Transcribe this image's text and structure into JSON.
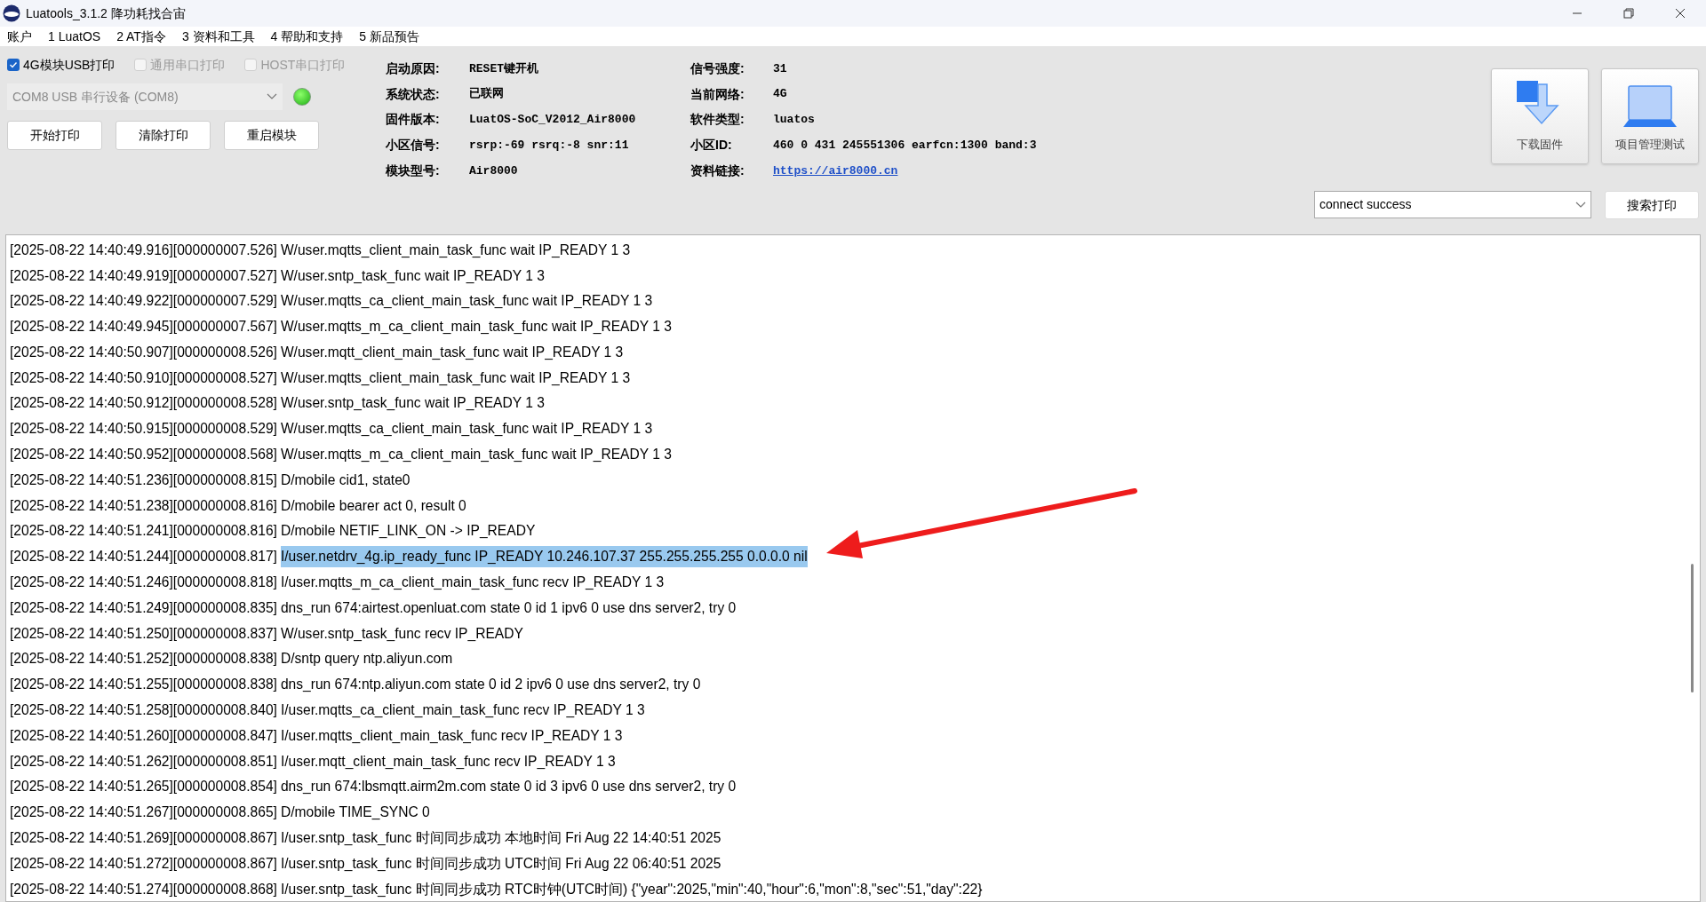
{
  "window": {
    "title": "Luatools_3.1.2 降功耗找合宙"
  },
  "menu": [
    "账户",
    "1 LuatOS",
    "2 AT指令",
    "3 资料和工具",
    "4 帮助和支持",
    "5 新品预告"
  ],
  "print_options": [
    {
      "label": "4G模块USB打印",
      "checked": true,
      "disabled": false
    },
    {
      "label": "通用串口打印",
      "checked": false,
      "disabled": true
    },
    {
      "label": "HOST串口打印",
      "checked": false,
      "disabled": true
    }
  ],
  "port": {
    "value": "COM8 USB 串行设备 (COM8)",
    "disabled": true
  },
  "connection_led": {
    "on": true
  },
  "actions": [
    "开始打印",
    "清除打印",
    "重启模块"
  ],
  "info_left": [
    {
      "label": "启动原因:",
      "value": "RESET键开机"
    },
    {
      "label": "系统状态:",
      "value": "已联网"
    },
    {
      "label": "固件版本:",
      "value": "LuatOS-SoC_V2012_Air8000"
    },
    {
      "label": "小区信号:",
      "value": "rsrp:-69 rsrq:-8 snr:11"
    },
    {
      "label": "模块型号:",
      "value": "Air8000"
    }
  ],
  "info_right": [
    {
      "label": "信号强度:",
      "value": "31",
      "kind": "text"
    },
    {
      "label": "当前网络:",
      "value": "4G",
      "kind": "text"
    },
    {
      "label": "软件类型:",
      "value": "luatos",
      "kind": "text"
    },
    {
      "label": "小区ID:",
      "value": "460 0 431 245551306 earfcn:1300 band:3",
      "kind": "text"
    },
    {
      "label": "资料链接:",
      "value": "https://air8000.cn",
      "kind": "link"
    }
  ],
  "tiles": [
    {
      "label": "下载固件",
      "kind": "download"
    },
    {
      "label": "项目管理测试",
      "kind": "laptop"
    }
  ],
  "search": {
    "value": "connect success",
    "button": "搜索打印"
  },
  "log": [
    {
      "stamp": "[2025-08-22 14:40:49.916][000000007.526]",
      "message": "W/user.mqtts_client_main_task_func wait IP_READY 1 3",
      "selected": false
    },
    {
      "stamp": "[2025-08-22 14:40:49.919][000000007.527]",
      "message": "W/user.sntp_task_func wait IP_READY 1 3",
      "selected": false
    },
    {
      "stamp": "[2025-08-22 14:40:49.922][000000007.529]",
      "message": "W/user.mqtts_ca_client_main_task_func wait IP_READY 1 3",
      "selected": false
    },
    {
      "stamp": "[2025-08-22 14:40:49.945][000000007.567]",
      "message": "W/user.mqtts_m_ca_client_main_task_func wait IP_READY 1 3",
      "selected": false
    },
    {
      "stamp": "[2025-08-22 14:40:50.907][000000008.526]",
      "message": "W/user.mqtt_client_main_task_func wait IP_READY 1 3",
      "selected": false
    },
    {
      "stamp": "[2025-08-22 14:40:50.910][000000008.527]",
      "message": "W/user.mqtts_client_main_task_func wait IP_READY 1 3",
      "selected": false
    },
    {
      "stamp": "[2025-08-22 14:40:50.912][000000008.528]",
      "message": "W/user.sntp_task_func wait IP_READY 1 3",
      "selected": false
    },
    {
      "stamp": "[2025-08-22 14:40:50.915][000000008.529]",
      "message": "W/user.mqtts_ca_client_main_task_func wait IP_READY 1 3",
      "selected": false
    },
    {
      "stamp": "[2025-08-22 14:40:50.952][000000008.568]",
      "message": "W/user.mqtts_m_ca_client_main_task_func wait IP_READY 1 3",
      "selected": false
    },
    {
      "stamp": "[2025-08-22 14:40:51.236][000000008.815]",
      "message": "D/mobile cid1, state0",
      "selected": false
    },
    {
      "stamp": "[2025-08-22 14:40:51.238][000000008.816]",
      "message": "D/mobile bearer act 0, result 0",
      "selected": false
    },
    {
      "stamp": "[2025-08-22 14:40:51.241][000000008.816]",
      "message": "D/mobile NETIF_LINK_ON -> IP_READY",
      "selected": false
    },
    {
      "stamp": "[2025-08-22 14:40:51.244][000000008.817]",
      "message": "I/user.netdrv_4g.ip_ready_func IP_READY 10.246.107.37 255.255.255.255 0.0.0.0 nil",
      "selected": true
    },
    {
      "stamp": "[2025-08-22 14:40:51.246][000000008.818]",
      "message": "I/user.mqtts_m_ca_client_main_task_func recv IP_READY 1 3",
      "selected": false
    },
    {
      "stamp": "[2025-08-22 14:40:51.249][000000008.835]",
      "message": "dns_run 674:airtest.openluat.com state 0 id 1 ipv6 0 use dns server2, try 0",
      "selected": false
    },
    {
      "stamp": "[2025-08-22 14:40:51.250][000000008.837]",
      "message": "W/user.sntp_task_func recv IP_READY",
      "selected": false
    },
    {
      "stamp": "[2025-08-22 14:40:51.252][000000008.838]",
      "message": "D/sntp query ntp.aliyun.com",
      "selected": false
    },
    {
      "stamp": "[2025-08-22 14:40:51.255][000000008.838]",
      "message": "dns_run 674:ntp.aliyun.com state 0 id 2 ipv6 0 use dns server2, try 0",
      "selected": false
    },
    {
      "stamp": "[2025-08-22 14:40:51.258][000000008.840]",
      "message": "I/user.mqtts_ca_client_main_task_func recv IP_READY 1 3",
      "selected": false
    },
    {
      "stamp": "[2025-08-22 14:40:51.260][000000008.847]",
      "message": "I/user.mqtts_client_main_task_func recv IP_READY 1 3",
      "selected": false
    },
    {
      "stamp": "[2025-08-22 14:40:51.262][000000008.851]",
      "message": "I/user.mqtt_client_main_task_func recv IP_READY 1 3",
      "selected": false
    },
    {
      "stamp": "[2025-08-22 14:40:51.265][000000008.854]",
      "message": "dns_run 674:lbsmqtt.airm2m.com state 0 id 3 ipv6 0 use dns server2, try 0",
      "selected": false
    },
    {
      "stamp": "[2025-08-22 14:40:51.267][000000008.865]",
      "message": "D/mobile TIME_SYNC 0",
      "selected": false
    },
    {
      "stamp": "[2025-08-22 14:40:51.269][000000008.867]",
      "message": "I/user.sntp_task_func 时间同步成功 本地时间 Fri Aug 22 14:40:51 2025",
      "selected": false
    },
    {
      "stamp": "[2025-08-22 14:40:51.272][000000008.867]",
      "message": "I/user.sntp_task_func 时间同步成功 UTC时间 Fri Aug 22 06:40:51 2025",
      "selected": false
    },
    {
      "stamp": "[2025-08-22 14:40:51.274][000000008.868]",
      "message": "I/user.sntp_task_func 时间同步成功 RTC时钟(UTC时间) {\"year\":2025,\"min\":40,\"hour\":6,\"mon\":8,\"sec\":51,\"day\":22}",
      "selected": false
    }
  ]
}
